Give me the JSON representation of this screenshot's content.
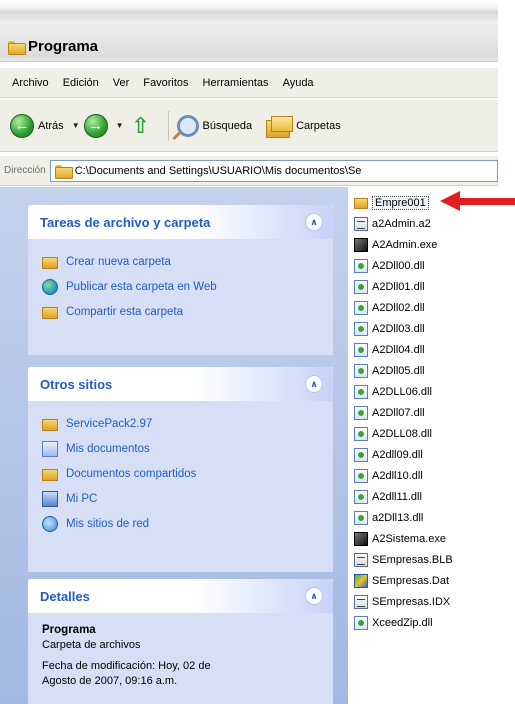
{
  "window": {
    "title": "Programa"
  },
  "menu": [
    "Archivo",
    "Edición",
    "Ver",
    "Favoritos",
    "Herramientas",
    "Ayuda"
  ],
  "toolbar": {
    "back_label": "Atrás",
    "search_label": "Búsqueda",
    "folders_label": "Carpetas"
  },
  "address": {
    "label": "Dirección",
    "value": "C:\\Documents and Settings\\USUARIO\\Mis documentos\\Se"
  },
  "tasks_panel": {
    "title": "Tareas de archivo y carpeta",
    "items": [
      "Crear nueva carpeta",
      "Publicar esta carpeta en Web",
      "Compartir esta carpeta"
    ]
  },
  "places_panel": {
    "title": "Otros sitios",
    "items": [
      "ServicePack2.97",
      "Mis documentos",
      "Documentos compartidos",
      "Mi PC",
      "Mis sitios de red"
    ]
  },
  "details_panel": {
    "title": "Detalles",
    "name": "Programa",
    "type": "Carpeta de archivos",
    "modified_line1": "Fecha de modificación: Hoy, 02 de",
    "modified_line2": "Agosto de 2007, 09:16 a.m."
  },
  "files": [
    {
      "name": "Empre001",
      "icon": "folder-icon",
      "selected": true
    },
    {
      "name": "a2Admin.a2",
      "icon": "text-file-icon"
    },
    {
      "name": "A2Admin.exe",
      "icon": "exe-icon"
    },
    {
      "name": "A2Dll00.dll",
      "icon": "dll-icon"
    },
    {
      "name": "A2Dll01.dll",
      "icon": "dll-icon"
    },
    {
      "name": "A2Dll02.dll",
      "icon": "dll-icon"
    },
    {
      "name": "A2Dll03.dll",
      "icon": "dll-icon"
    },
    {
      "name": "A2Dll04.dll",
      "icon": "dll-icon"
    },
    {
      "name": "A2Dll05.dll",
      "icon": "dll-icon"
    },
    {
      "name": "A2DLL06.dll",
      "icon": "dll-icon"
    },
    {
      "name": "A2Dll07.dll",
      "icon": "dll-icon"
    },
    {
      "name": "A2DLL08.dll",
      "icon": "dll-icon"
    },
    {
      "name": "A2dll09.dll",
      "icon": "dll-icon"
    },
    {
      "name": "A2dll10.dll",
      "icon": "dll-icon"
    },
    {
      "name": "A2dll11.dll",
      "icon": "dll-icon"
    },
    {
      "name": "a2Dll13.dll",
      "icon": "dll-icon"
    },
    {
      "name": "A2Sistema.exe",
      "icon": "exe-icon"
    },
    {
      "name": "SEmpresas.BLB",
      "icon": "text-file-icon"
    },
    {
      "name": "SEmpresas.Dat",
      "icon": "dat-file-icon"
    },
    {
      "name": "SEmpresas.IDX",
      "icon": "text-file-icon"
    },
    {
      "name": "XceedZip.dll",
      "icon": "dll-icon"
    }
  ],
  "colors": {
    "accent_arrow": "#e02020",
    "panel_title": "#215dc6",
    "task_pane_bg": "#a2b8e2"
  }
}
